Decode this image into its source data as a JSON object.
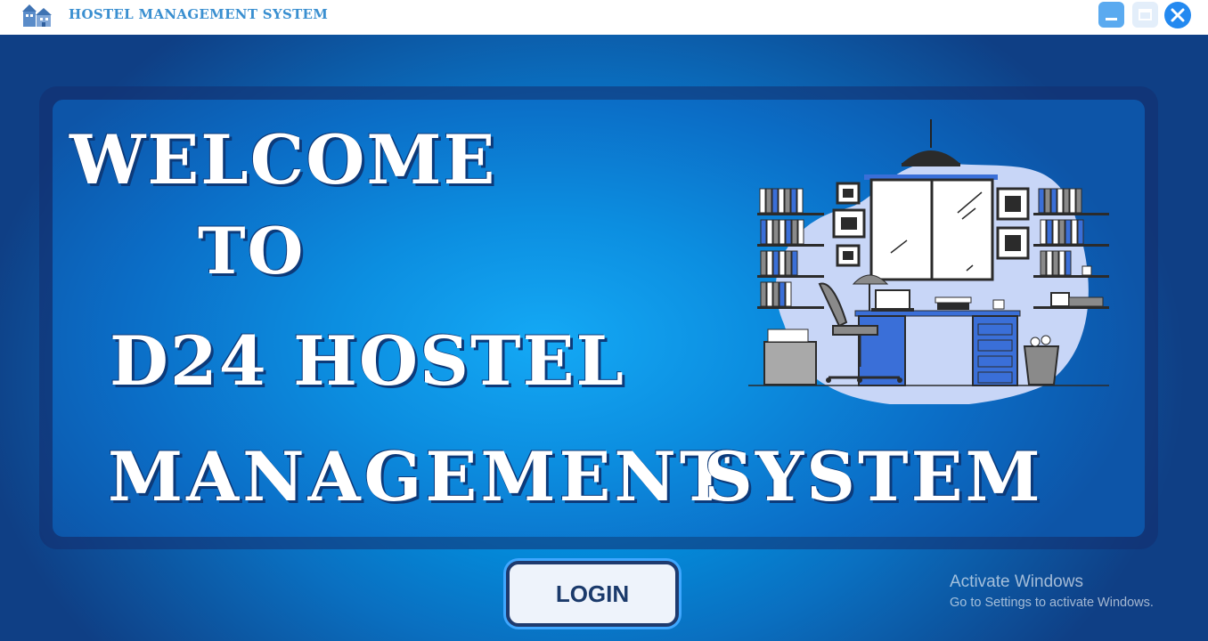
{
  "window": {
    "title": "HOSTEL MANAGEMENT SYSTEM",
    "app_icon": "hostel-building-icon",
    "controls": {
      "minimize_icon": "minimize-icon",
      "maximize_icon": "maximize-icon",
      "close_icon": "close-icon"
    }
  },
  "hero": {
    "line1": "WELCOME",
    "line2": "TO",
    "line3": "D24 HOSTEL",
    "line4a": "MANAGEMENT",
    "line4b": "SYSTEM",
    "illustration": "office-desk-illustration"
  },
  "login": {
    "label": "LOGIN"
  },
  "watermark": {
    "title": "Activate Windows",
    "subtitle": "Go to Settings to activate Windows."
  },
  "colors": {
    "accent": "#3a8fd0",
    "background_center": "#00b4ff",
    "background_edge": "#0f3f85",
    "button_text": "#1b3a6b"
  }
}
